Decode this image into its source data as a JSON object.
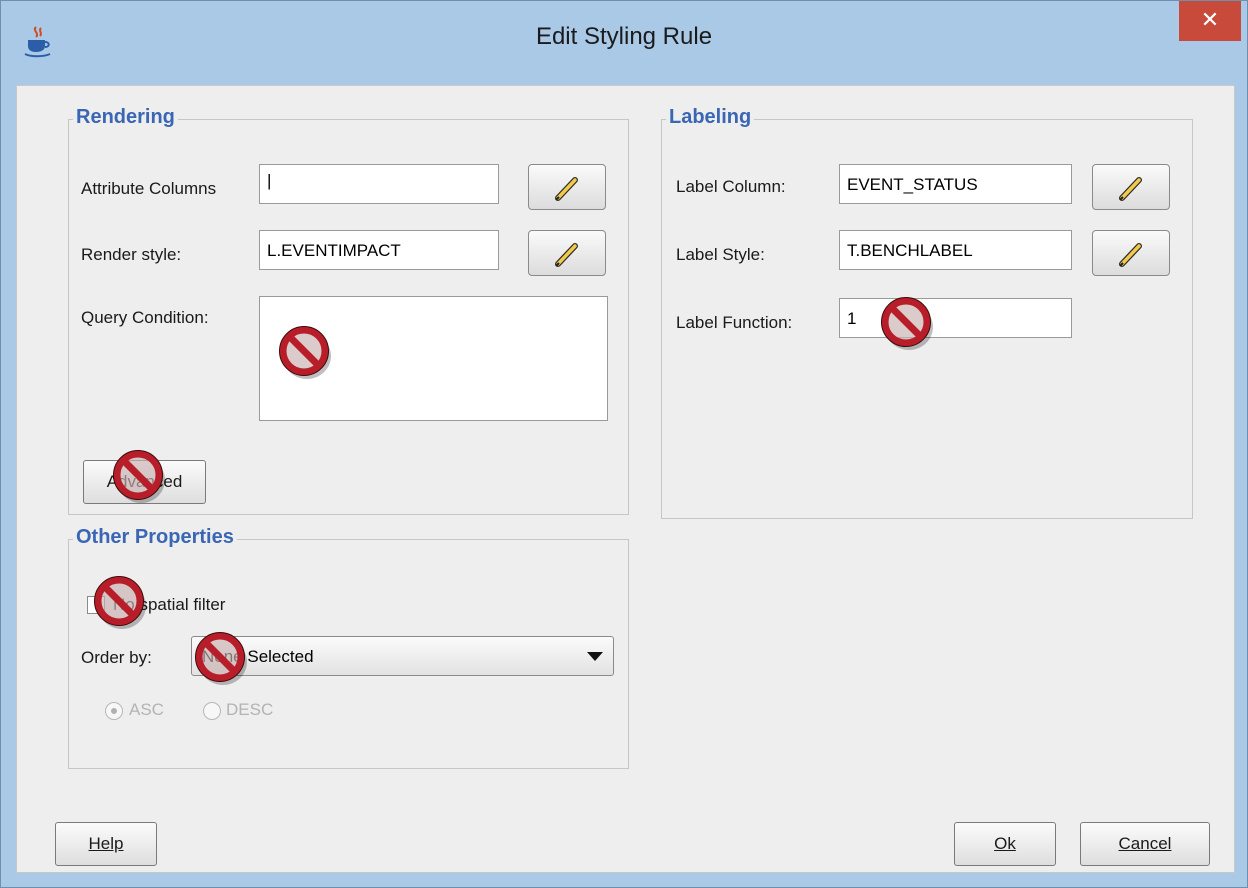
{
  "window": {
    "title": "Edit Styling Rule",
    "close_glyph": "✕"
  },
  "rendering": {
    "legend": "Rendering",
    "attribute_columns_label": "Attribute Columns",
    "attribute_columns_value": "|",
    "render_style_label": "Render style:",
    "render_style_value": "L.EVENTIMPACT",
    "query_condition_label": "Query Condition:",
    "advanced_button": "Advanced"
  },
  "labeling": {
    "legend": "Labeling",
    "label_column_label": "Label Column:",
    "label_column_value": "EVENT_STATUS",
    "label_style_label": "Label Style:",
    "label_style_value": "T.BENCHLABEL",
    "label_function_label": "Label Function:",
    "label_function_value": "1"
  },
  "other_properties": {
    "legend": "Other Properties",
    "spatial_filter_label": "No spatial filter",
    "order_by_label": "Order by:",
    "order_by_value": "None Selected",
    "asc_label": "ASC",
    "desc_label": "DESC"
  },
  "footer": {
    "help_button": "Help",
    "ok_button": "Ok",
    "cancel_button": "Cancel"
  },
  "icons": {
    "app": "java-cup-icon",
    "edit": "pencil-icon",
    "cursor": "not-allowed-cursor-icon"
  },
  "colors": {
    "legend": "#3a66b4",
    "title_bar": "#a9c9e6",
    "close": "#c74a3a"
  }
}
